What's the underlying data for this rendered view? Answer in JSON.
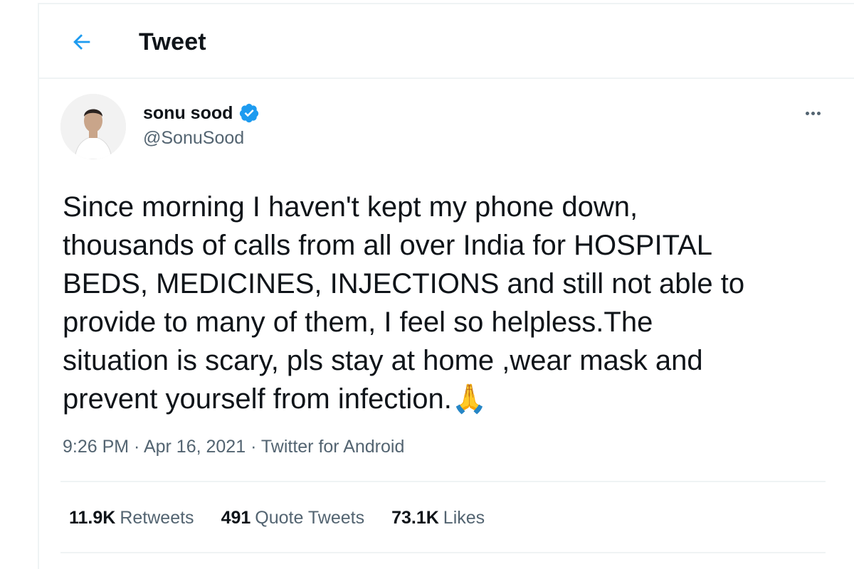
{
  "header": {
    "title": "Tweet",
    "back_icon": "arrow-left-icon"
  },
  "tweet": {
    "author": {
      "name": "sonu sood",
      "handle": "@SonuSood",
      "verified": true,
      "avatar_icon": "avatar-photo"
    },
    "text": "Since morning I haven't kept my phone down,\nthousands of calls from all over India for HOSPITAL\nBEDS, MEDICINES, INJECTIONS and still not able to\nprovide to many of them, I feel so helpless.The\nsituation is scary, pls stay at home ,wear mask and\nprevent yourself from infection.🙏",
    "time": "9:26 PM",
    "date": "Apr 16, 2021",
    "source": "Twitter for Android",
    "separator": " · "
  },
  "stats": {
    "retweets_count": "11.9K",
    "retweets_label": "Retweets",
    "quotes_count": "491",
    "quotes_label": "Quote Tweets",
    "likes_count": "73.1K",
    "likes_label": "Likes"
  },
  "colors": {
    "accent": "#1d9bf0",
    "text": "#0f1419",
    "secondary": "#536471",
    "divider": "#eff3f4"
  }
}
